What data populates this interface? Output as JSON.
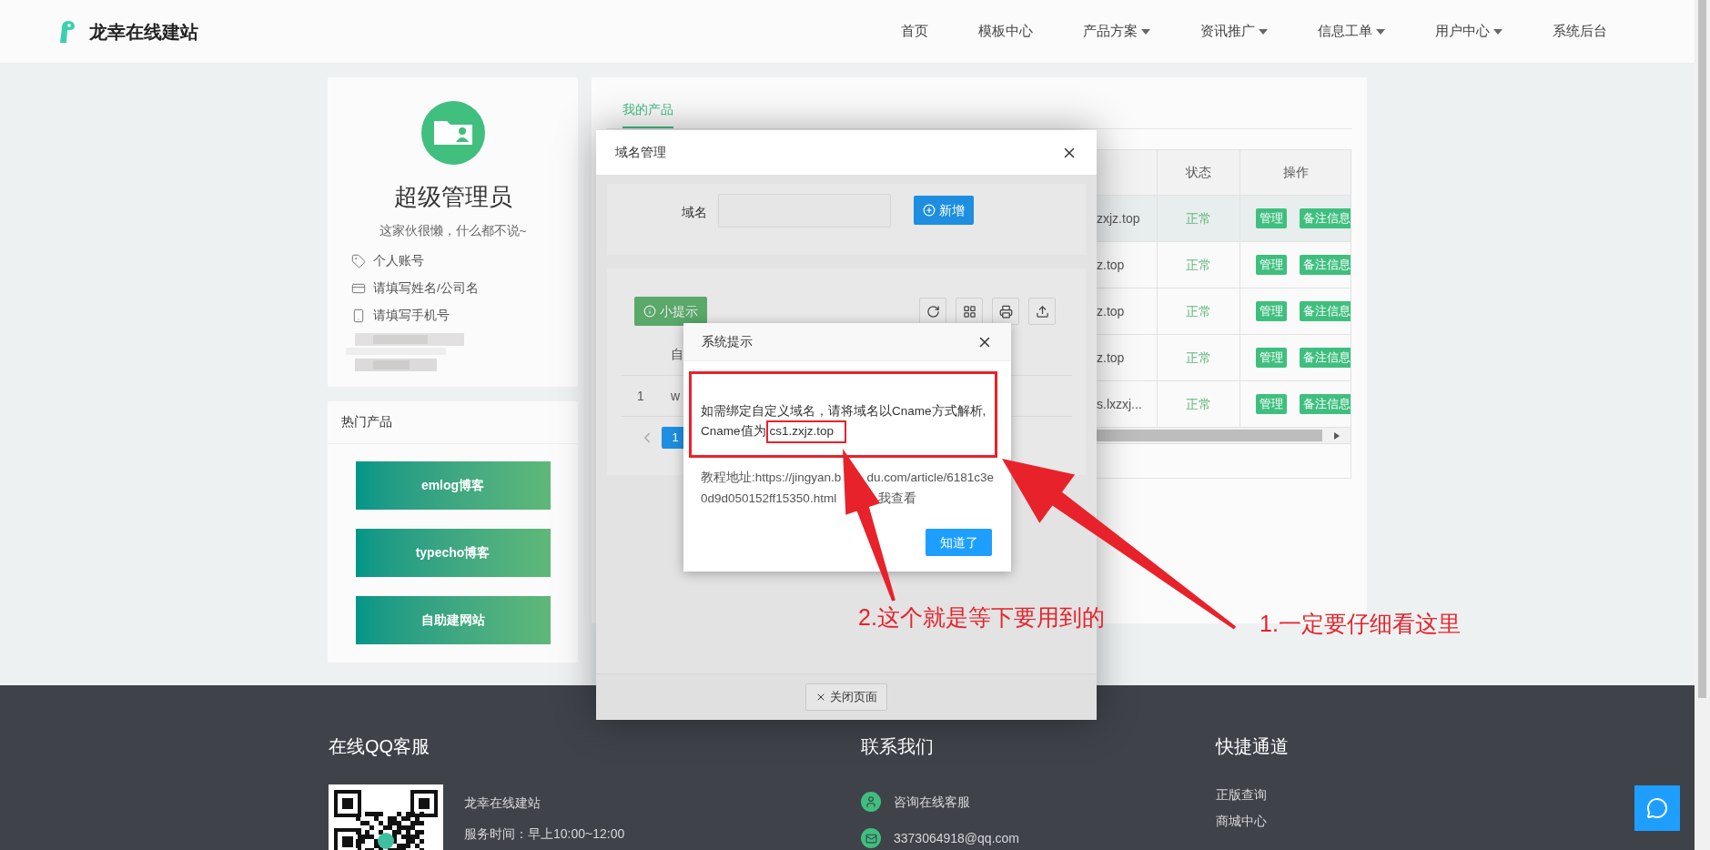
{
  "header": {
    "brand": "龙幸在线建站",
    "nav": [
      {
        "label": "首页",
        "dropdown": false
      },
      {
        "label": "模板中心",
        "dropdown": false
      },
      {
        "label": "产品方案",
        "dropdown": true
      },
      {
        "label": "资讯推广",
        "dropdown": true
      },
      {
        "label": "信息工单",
        "dropdown": true
      },
      {
        "label": "用户中心",
        "dropdown": true
      },
      {
        "label": "系统后台",
        "dropdown": false
      }
    ]
  },
  "profile": {
    "name": "超级管理员",
    "motto": "这家伙很懒，什么都不说~",
    "fields": [
      {
        "kind": "account",
        "text": "个人账号"
      },
      {
        "kind": "company",
        "text": "请填写姓名/公司名"
      },
      {
        "kind": "phone",
        "text": "请填写手机号"
      }
    ]
  },
  "hot_products": {
    "title": "热门产品",
    "items": [
      "emlog博客",
      "typecho博客",
      "自助建网站"
    ]
  },
  "products": {
    "tabs": [
      {
        "label": "我的产品",
        "selected": true
      }
    ],
    "table": {
      "columns": [
        "状态",
        "操作"
      ],
      "rows": [
        {
          "column_1": "zxjz.top",
          "status": "正常",
          "actions": [
            "管理",
            "备注信息"
          ],
          "highlighted": true
        },
        {
          "column_1": "z.top",
          "status": "正常",
          "actions": [
            "管理",
            "备注信息"
          ],
          "highlighted": false
        },
        {
          "column_1": "z.top",
          "status": "正常",
          "actions": [
            "管理",
            "备注信息"
          ],
          "highlighted": false
        },
        {
          "column_1": "z.top",
          "status": "正常",
          "actions": [
            "管理",
            "备注信息"
          ],
          "highlighted": false
        },
        {
          "column_1": "s.lxzxj...",
          "status": "正常",
          "actions": [
            "管理",
            "备注信息"
          ],
          "highlighted": false
        }
      ]
    }
  },
  "domain_modal": {
    "title": "域名管理",
    "field_label": "域名",
    "add_button": "新增",
    "tip_button": "小提示",
    "table_header": "自",
    "row": {
      "index": "1",
      "value": "w"
    },
    "page": "1",
    "close_button": "关闭页面"
  },
  "alert": {
    "title": "系统提示",
    "line": "如需绑定自定义域名，请将域名以Cname方式解析,",
    "cname_label": "Cname值为",
    "cname_value": "cs1.zxjz.top",
    "tutorial": [
      [
        "教程地址:https://jingyan.b",
        "du.com/article/6181c3e"
      ],
      [
        "0d9d050152ff15350.html",
        "我查看"
      ]
    ],
    "ok_button": "知道了"
  },
  "annotations": [
    "2.这个就是等下要用到的",
    "1.一定要仔细看这里"
  ],
  "footer": {
    "columns": [
      {
        "title": "在线QQ客服",
        "lines": [
          "龙幸在线建站",
          "服务时间：早上10:00~12:00"
        ]
      },
      {
        "title": "联系我们",
        "contacts": [
          {
            "kind": "qq",
            "text": "咨询在线客服"
          },
          {
            "kind": "email",
            "text": "3373064918@qq.com"
          }
        ]
      },
      {
        "title": "快捷通道",
        "links": [
          "正版查询",
          "商城中心"
        ]
      }
    ]
  }
}
